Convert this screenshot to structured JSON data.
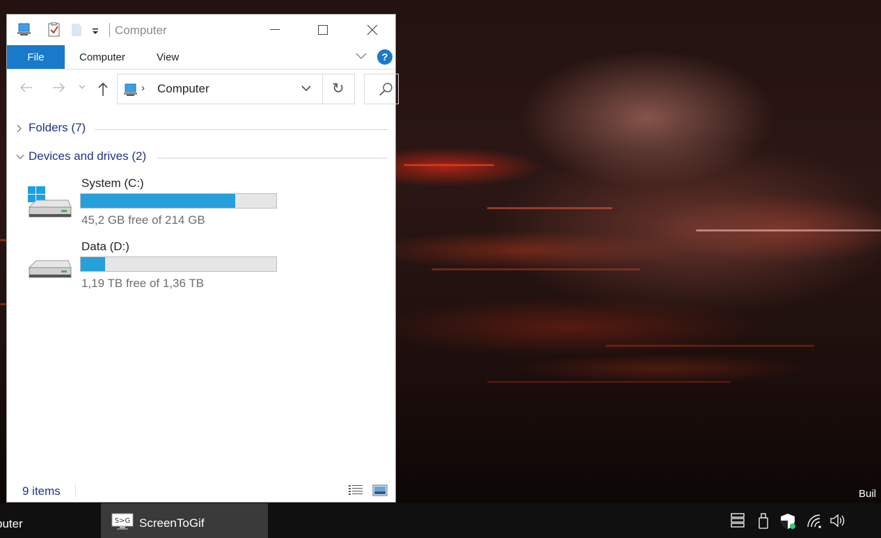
{
  "window": {
    "title": "Computer",
    "ribbon_tabs": {
      "file": "File",
      "computer": "Computer",
      "view": "View"
    },
    "help_label": "?"
  },
  "address": {
    "path": "Computer",
    "chevron": "›",
    "refresh_glyph": "↻"
  },
  "groups": {
    "folders": {
      "label": "Folders (7)",
      "expanded": false
    },
    "devices": {
      "label": "Devices and drives (2)",
      "expanded": true
    }
  },
  "drives": [
    {
      "name": "System (C:)",
      "free_text": "45,2 GB free of 214 GB",
      "used_fraction": 0.789,
      "icon": "windows-drive-icon"
    },
    {
      "name": "Data (D:)",
      "free_text": "1,19 TB free of 1,36 TB",
      "used_fraction": 0.125,
      "icon": "drive-icon"
    }
  ],
  "status": {
    "item_count": "9 items"
  },
  "taskbar": {
    "explorer_label": "puter",
    "screentogif_label": "ScreenToGif",
    "screentogif_icon_text": "S>G"
  },
  "desktop": {
    "build_text": "Buil"
  },
  "colors": {
    "accent": "#1979ca",
    "drive_fill": "#26a0da",
    "group_text": "#1e3287"
  }
}
